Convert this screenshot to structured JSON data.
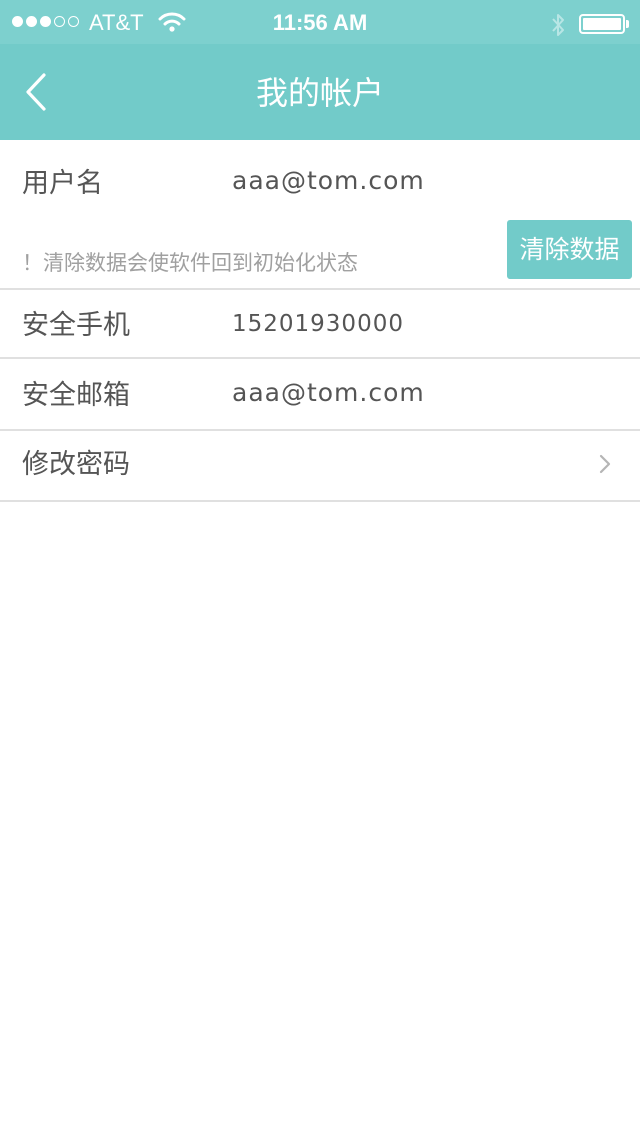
{
  "status_bar": {
    "carrier": "AT&T",
    "time": "11:56 AM",
    "signal_bars_filled": 3,
    "signal_bars_total": 5,
    "icons": [
      "wifi-icon",
      "bluetooth-icon",
      "battery-icon"
    ]
  },
  "nav": {
    "title": "我的帐户",
    "back_icon": "chevron-left-icon"
  },
  "account": {
    "username_label": "用户名",
    "username_value": "aaa@tom.com",
    "warning": "！清除数据会使软件回到初始化状态",
    "clear_button": "清除数据",
    "phone_label": "安全手机",
    "phone_value": "15201930000",
    "email_label": "安全邮箱",
    "email_value": "aaa@tom.com",
    "password_label": "修改密码",
    "password_icon": "chevron-right-icon"
  },
  "colors": {
    "status_bar": "#7dd0ce",
    "nav_bar": "#72cbc9",
    "accent": "#72cbc9",
    "label_text": "#555555",
    "hint_text": "#a0a0a0",
    "divider": "#e0e0e0"
  }
}
